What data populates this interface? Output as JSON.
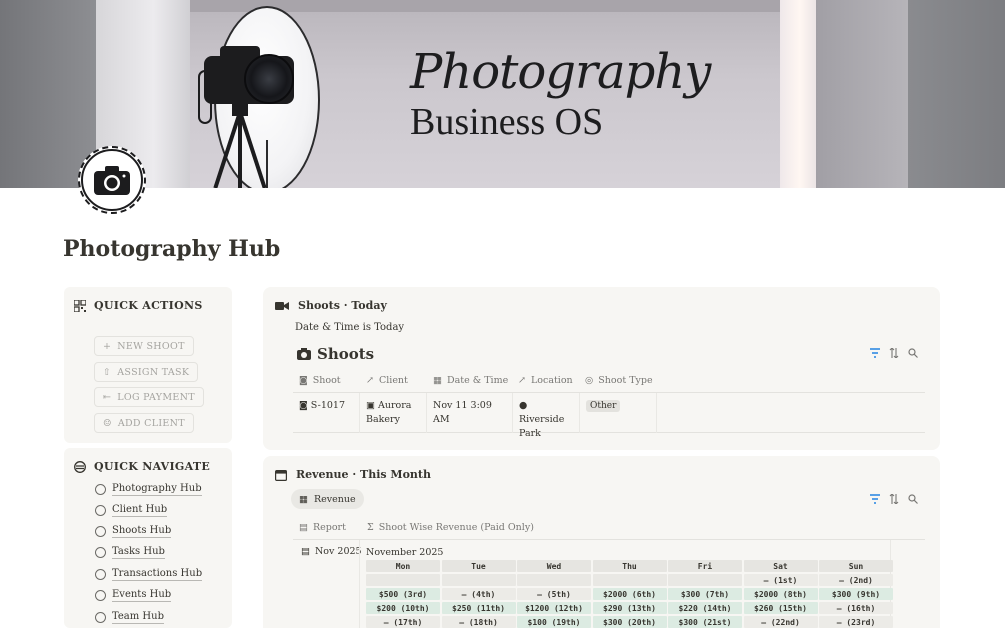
{
  "cover": {
    "script_title": "Photography",
    "main_title": "Business OS"
  },
  "page": {
    "title": "Photography Hub",
    "icon": "camera-icon"
  },
  "quick_actions": {
    "heading": "QUICK ACTIONS",
    "icon": "grid-icon",
    "buttons": [
      {
        "label": "NEW SHOOT",
        "icon": "plus-icon"
      },
      {
        "label": "ASSIGN TASK",
        "icon": "share-icon"
      },
      {
        "label": "LOG PAYMENT",
        "icon": "log-icon"
      },
      {
        "label": "ADD CLIENT",
        "icon": "person-icon"
      }
    ]
  },
  "quick_navigate": {
    "heading": "QUICK NAVIGATE",
    "icon": "compass-icon",
    "items": [
      {
        "label": "Photography Hub",
        "icon": "camera-icon"
      },
      {
        "label": "Client Hub",
        "icon": "person-icon"
      },
      {
        "label": "Shoots Hub",
        "icon": "camera-icon"
      },
      {
        "label": "Tasks Hub",
        "icon": "list-icon"
      },
      {
        "label": "Transactions Hub",
        "icon": "money-icon"
      },
      {
        "label": "Events Hub",
        "icon": "person-icon"
      },
      {
        "label": "Team Hub",
        "icon": "team-icon"
      }
    ]
  },
  "shoots_today": {
    "heading": "Shoots · Today",
    "icon": "video-icon",
    "filter": "Date & Time is Today",
    "db_title": "Shoots",
    "columns": [
      {
        "label": "Shoot",
        "icon": "camera-icon"
      },
      {
        "label": "Client",
        "icon": "arrow-up-right-icon"
      },
      {
        "label": "Date & Time",
        "icon": "calendar-icon"
      },
      {
        "label": "Location",
        "icon": "arrow-up-right-icon"
      },
      {
        "label": "Shoot Type",
        "icon": "circle-icon"
      }
    ],
    "rows": [
      {
        "shoot": "S-1017",
        "client_line1": "Aurora",
        "client_line2": "Bakery",
        "datetime": "Nov 11 3:09 AM",
        "location_line1": "Riverside",
        "location_line2": "Park",
        "shoot_type": "Other"
      }
    ]
  },
  "revenue": {
    "heading": "Revenue · This Month",
    "icon": "calendar-icon",
    "view_tab": "Revenue",
    "columns": [
      {
        "label": "Report",
        "icon": "doc-icon"
      },
      {
        "label": "Shoot Wise Revenue (Paid Only)",
        "icon": "sigma-icon"
      }
    ],
    "report_name": "Nov 2025",
    "calendar_title": "November 2025",
    "weekdays": [
      "Mon",
      "Tue",
      "Wed",
      "Thu",
      "Fri",
      "Sat",
      "Sun"
    ],
    "weeks": [
      [
        "",
        "",
        "",
        "",
        "",
        "— (1st)",
        "— (2nd)"
      ],
      [
        "$500 (3rd)",
        "— (4th)",
        "— (5th)",
        "$2000 (6th)",
        "$300 (7th)",
        "$2000 (8th)",
        "$300 (9th)"
      ],
      [
        "$200 (10th)",
        "$250 (11th)",
        "$1200 (12th)",
        "$290 (13th)",
        "$220 (14th)",
        "$260 (15th)",
        "— (16th)"
      ],
      [
        "— (17th)",
        "— (18th)",
        "$100 (19th)",
        "$300 (20th)",
        "$300 (21st)",
        "— (22nd)",
        "— (23rd)"
      ]
    ]
  }
}
